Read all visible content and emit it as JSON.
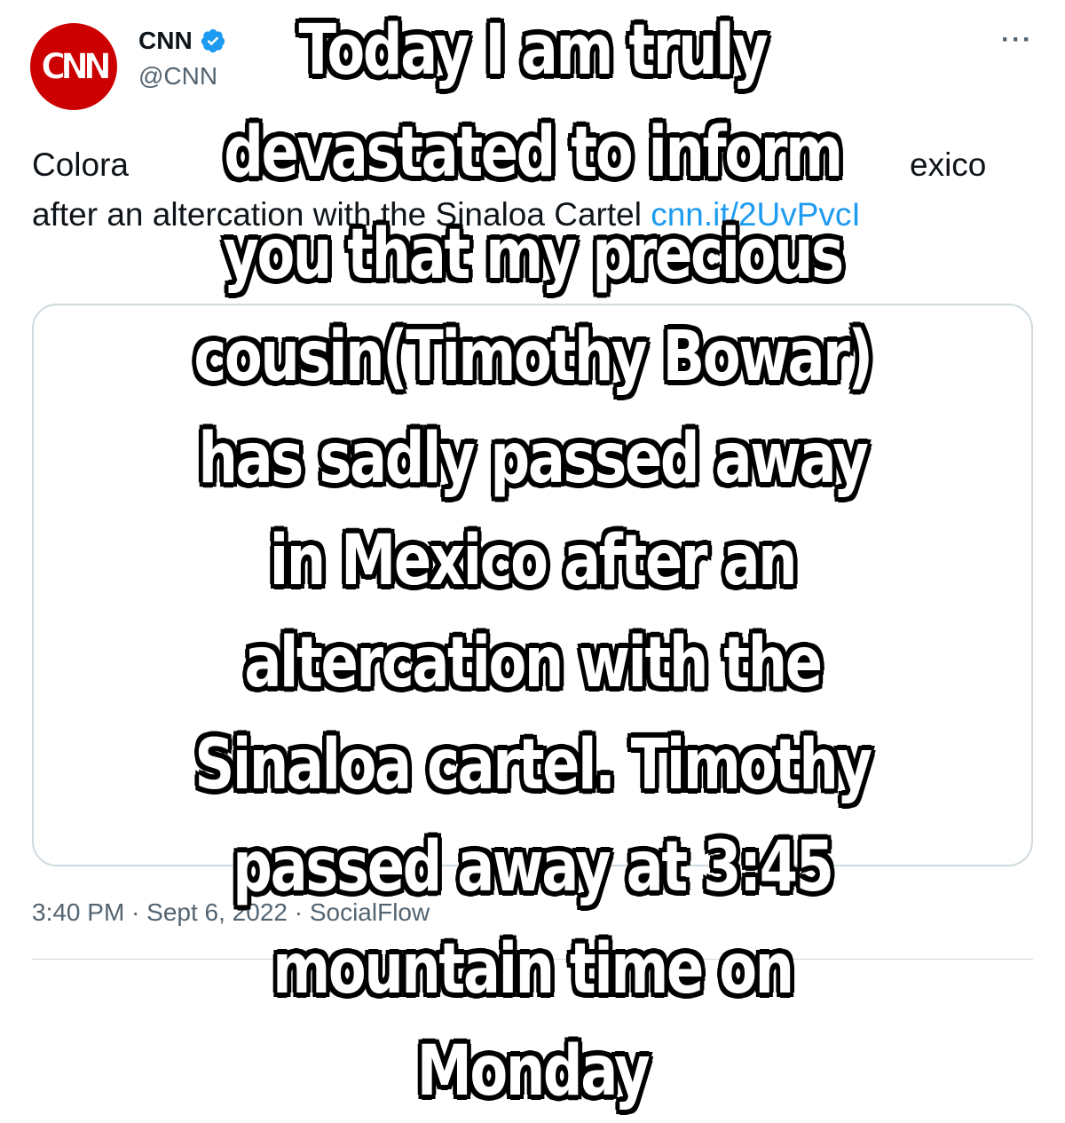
{
  "author": {
    "avatar_text": "CNN",
    "name": "CNN",
    "handle": "@CNN",
    "verified_icon": "verified-badge-icon",
    "brand_color": "#cc0000",
    "verified_color": "#1d9bf0"
  },
  "more_label": "···",
  "tweet": {
    "text_parts": [
      "Colora",
      "exico"
    ],
    "line2": "after an altercation with the Sinaloa Cartel ",
    "link": "cnn.it/2UvPvcI"
  },
  "footer": {
    "time": "3:40 PM · Sept 6, 2022 · SocialFlow"
  },
  "overlay": {
    "text": "Today I am truly devastated to inform you that my precious cousin(Timothy Bowar) has sadly passed away in Mexico after an altercation with the Sinaloa cartel. Timothy passed away at 3:45 mountain time on Monday"
  }
}
